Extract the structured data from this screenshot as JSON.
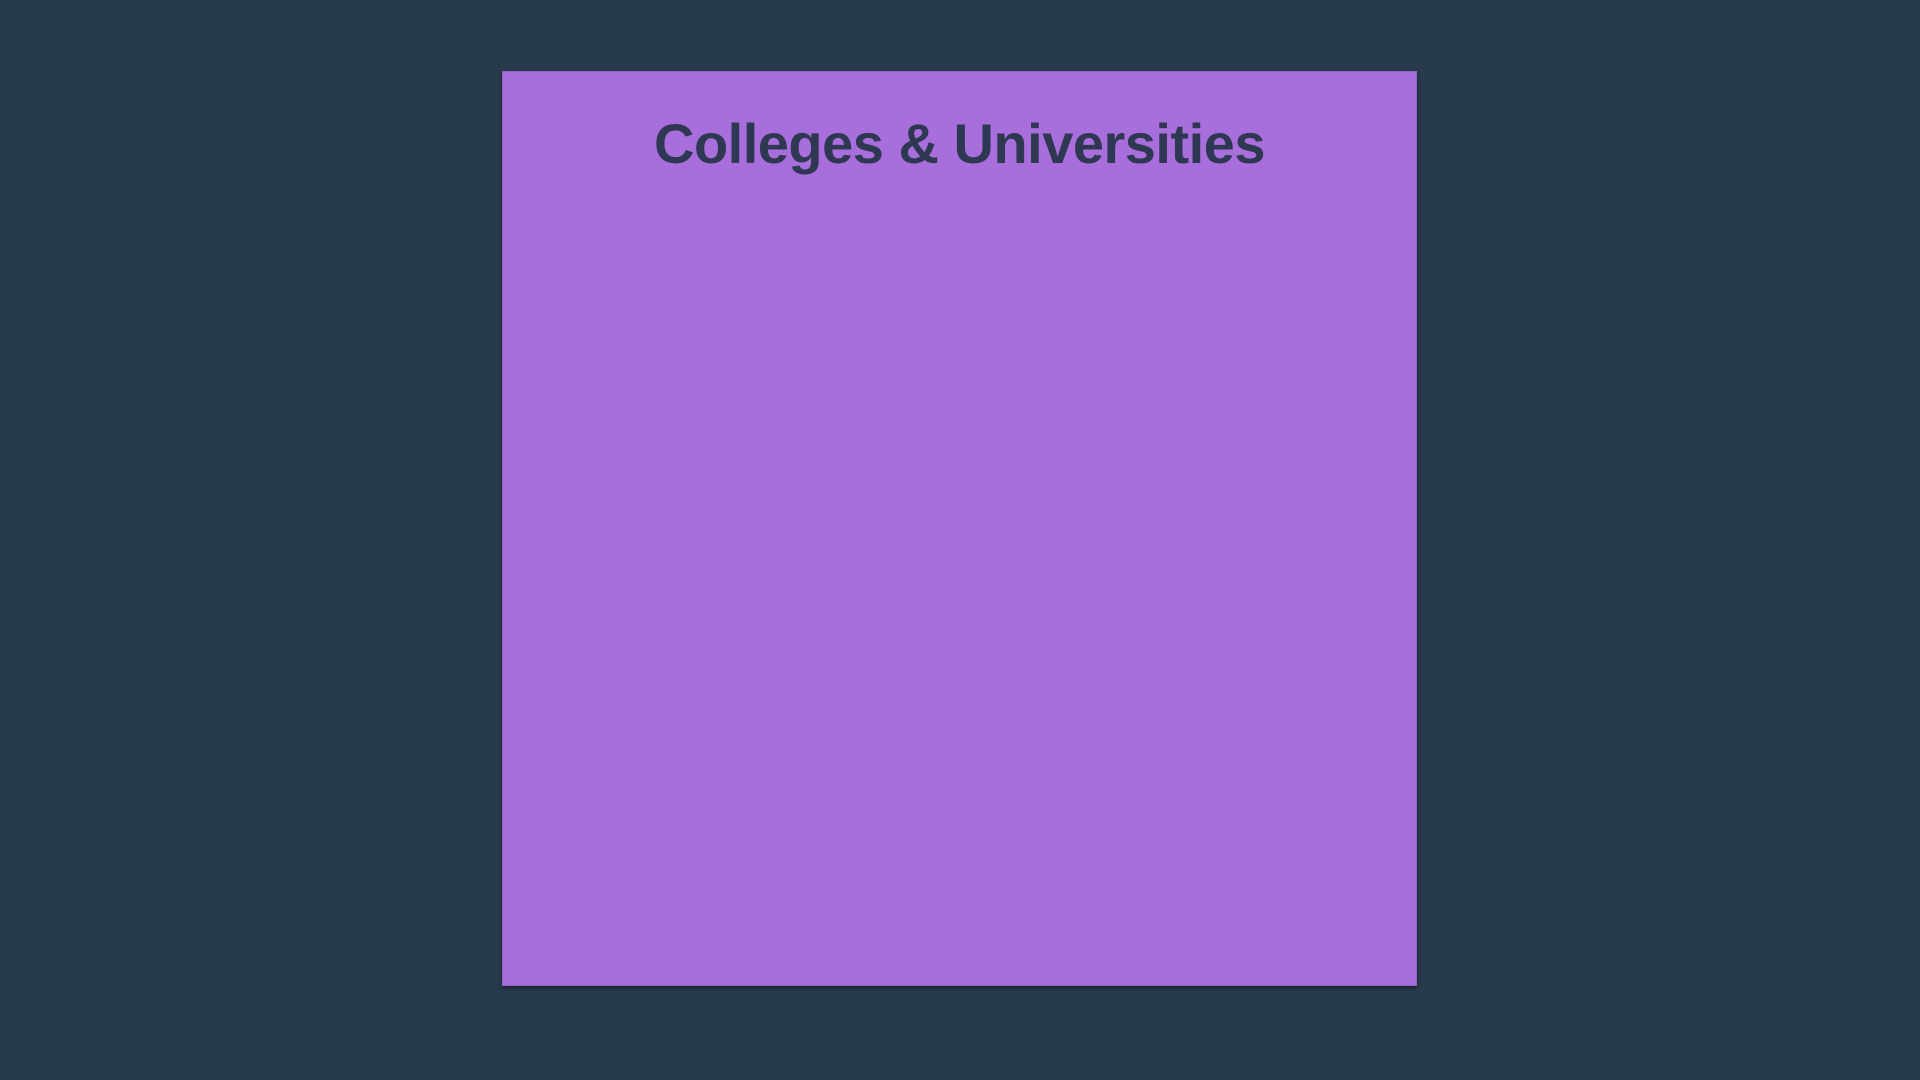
{
  "colors": {
    "background": "#283b4c",
    "card": "#a86fdc",
    "title_text": "#2f3852"
  },
  "card": {
    "title": "Colleges & Universities"
  }
}
